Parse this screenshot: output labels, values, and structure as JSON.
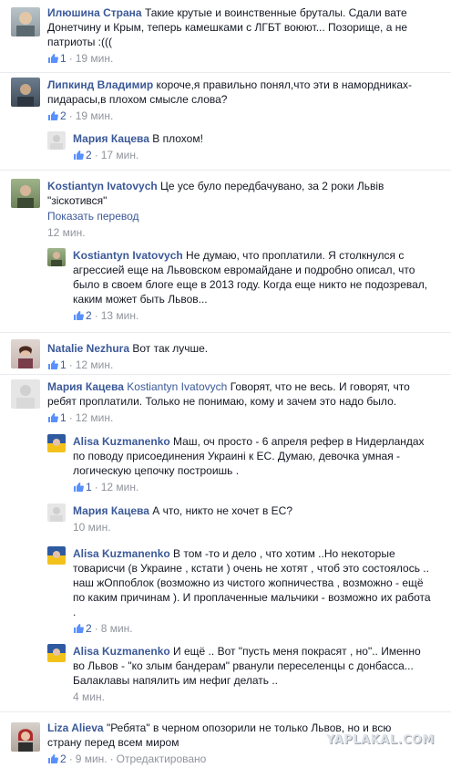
{
  "comments": [
    {
      "author": "Илюшина Страна",
      "text": "Такие крутые и воинственные бруталы. Сдали вате Донетчину и Крым, теперь камешками с ЛГБТ воюют... Позорище, а не патриоты :(((",
      "likes": "1",
      "time": "19 мин."
    },
    {
      "author": "Липкинд Владимир",
      "text": "короче,я правильно понял,что эти в намордниках-пидарасы,в плохом смысле слова?",
      "likes": "2",
      "time": "19 мин."
    },
    {
      "author": "Мария Кацева",
      "text": "В плохом!",
      "likes": "2",
      "time": "17 мин."
    },
    {
      "author": "Kostiantyn Ivatovych",
      "text": "Це усе було передбачувано, за 2 роки Львів \"зіскотився\"",
      "translate": "Показать перевод",
      "time": "12 мин."
    },
    {
      "author": "Kostiantyn Ivatovych",
      "text": "Не думаю, что проплатили. Я столкнулся с агрессией еще на Львовском евромайдане и подробно описал, что было в своем блоге еще в 2013 году. Когда еще никто не подозревал, каким может быть Львов...",
      "likes": "2",
      "time": "13 мин."
    },
    {
      "author": "Natalie Nezhura",
      "text": "Вот так лучше.",
      "likes": "1",
      "time": "12 мин."
    },
    {
      "author": "Мария Кацева",
      "mention": "Kostiantyn Ivatovych",
      "text": "Говорят, что не весь. И говорят, что ребят проплатили. Только не понимаю, кому и зачем это надо было.",
      "likes": "1",
      "time": "12 мин."
    },
    {
      "author": "Alisa Kuzmanenko",
      "text": "Маш, оч просто - 6 апреля рефер в Нидерландах по поводу присоединения Украині к ЕС. Думаю, девочка умная - логическую цепочку построишь .",
      "likes": "1",
      "time": "12 мин."
    },
    {
      "author": "Мария Кацева",
      "text": "А что, никто не хочет в ЕС?",
      "time": "10 мин."
    },
    {
      "author": "Alisa Kuzmanenko",
      "text": "В том -то и дело , что хотим ..Но некоторые товарисчи (в Украине , кстати ) очень не хотят , чтоб это состоялось .. наш жОппоблок (возможно из чистого жопничества , возможно - ещё по каким причинам ). И проплаченные мальчики - возможно их работа .",
      "likes": "2",
      "time": "8 мин."
    },
    {
      "author": "Alisa Kuzmanenko",
      "text": "И ещё .. Вот \"пусть меня покрасят , но\".. Именно во Львов - \"ко злым бандерам\" рванули переселенцы с донбасса... Балаклавы напялить им нефиг делать ..",
      "time": "4 мин."
    },
    {
      "author": "Liza Alieva",
      "text": "\"Ребята\" в черном опозорили не только Львов, но и всю страну перед всем миром",
      "likes": "2",
      "time": "9 мин.",
      "edited": "Отредактировано"
    }
  ],
  "watermark": "YAPLAKAL.COM",
  "colors": {
    "link": "#3b5998",
    "meta": "#90949c",
    "text": "#141823"
  }
}
